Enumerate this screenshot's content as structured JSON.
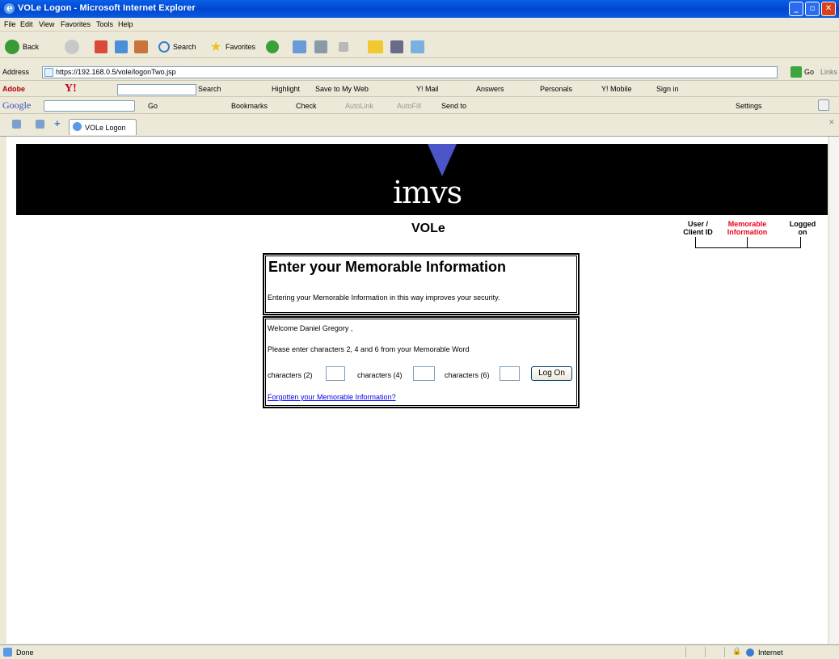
{
  "window": {
    "title": "VOLe Logon - Microsoft Internet Explorer",
    "buttons": [
      "_",
      "▫",
      "✕"
    ]
  },
  "menu": [
    "File",
    "Edit",
    "View",
    "Favorites",
    "Tools",
    "Help"
  ],
  "toolbar": {
    "back_label": "Back",
    "search_label": "Search",
    "favorites_label": "Favorites"
  },
  "address": {
    "label": "Address",
    "url": "https://192.168.0.5/vole/logonTwo.jsp",
    "go_label": "Go",
    "links_label": "Links"
  },
  "yahoo_bar": {
    "adobe_label": "Adobe",
    "search_label": "Search",
    "highlight_label": "Highlight",
    "save_label": "Save to My Web",
    "mail_label": "Y! Mail",
    "answers_label": "Answers",
    "personals_label": "Personals",
    "mobile_label": "Y! Mobile",
    "signin_label": "Sign in"
  },
  "google_bar": {
    "logo": "Google",
    "go_label": "Go",
    "bookmarks_label": "Bookmarks",
    "check_label": "Check",
    "autolink_label": "AutoLink",
    "autofill_label": "AutoFill",
    "sendto_label": "Send to",
    "settings_label": "Settings"
  },
  "tab": {
    "label": "VOLe Logon"
  },
  "page": {
    "logo_text": "imvs",
    "app_name": "VOLe",
    "steps": [
      {
        "line1": "User /",
        "line2": "Client ID",
        "color": "#000000"
      },
      {
        "line1": "Memorable",
        "line2": "Information",
        "color": "#e8001c"
      },
      {
        "line1": "Logged",
        "line2": "on",
        "color": "#000000"
      }
    ],
    "heading": "Enter your Memorable Information",
    "subtitle": "Entering your Memorable Information in this way improves your security.",
    "welcome": "Welcome Daniel Gregory ,",
    "instruction": "Please enter characters 2, 4 and 6 from your Memorable Word",
    "char_labels": [
      "characters (2)",
      "characters (4)",
      "characters (6)"
    ],
    "logon_label": "Log On",
    "forgot_link": "Forgotten your Memorable Information?"
  },
  "status": {
    "text": "Done",
    "zone": "Internet"
  }
}
